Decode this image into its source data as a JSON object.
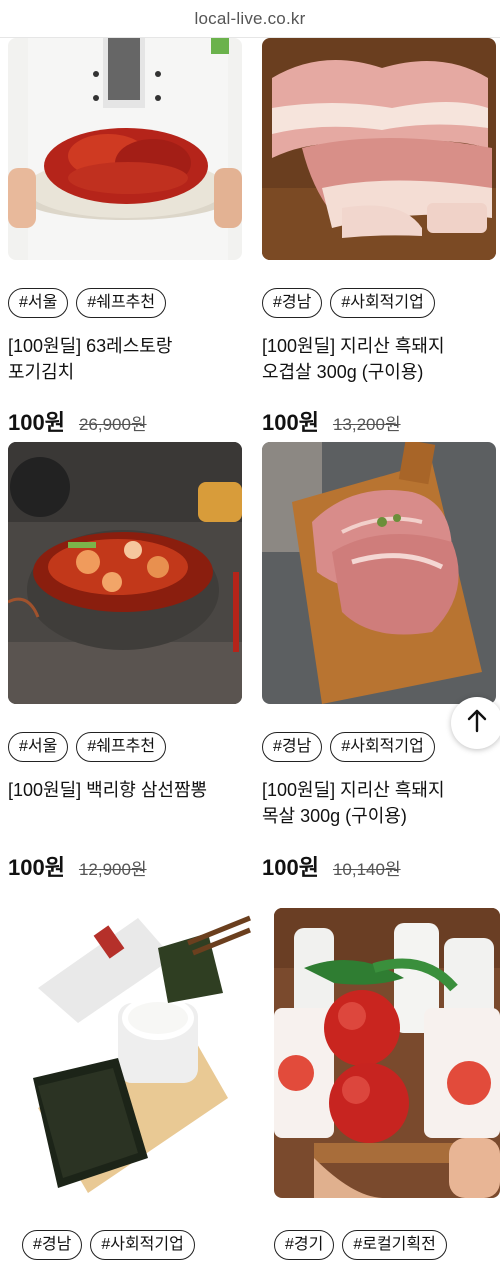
{
  "browser": {
    "url": "local-live.co.kr"
  },
  "products": [
    {
      "tags": [
        "#서울",
        "#쉐프추천"
      ],
      "title_lines": [
        "[100원딜] 63레스토랑",
        "포기김치"
      ],
      "price": "100원",
      "original_price": "26,900원"
    },
    {
      "tags": [
        "#경남",
        "#사회적기업"
      ],
      "title_lines": [
        "[100원딜] 지리산 흑돼지",
        "오겹살 300g (구이용)"
      ],
      "price": "100원",
      "original_price": "13,200원"
    },
    {
      "tags": [
        "#서울",
        "#쉐프추천"
      ],
      "title_lines": [
        "[100원딜] 백리향 삼선짬뽕",
        ""
      ],
      "price": "100원",
      "original_price": "12,900원"
    },
    {
      "tags": [
        "#경남",
        "#사회적기업"
      ],
      "title_lines": [
        "[100원딜] 지리산 흑돼지",
        "목살 300g (구이용)"
      ],
      "price": "100원",
      "original_price": "10,140원"
    },
    {
      "tags": [
        "#경남",
        "#사회적기업"
      ]
    },
    {
      "tags": [
        "#경기",
        "#로컬기획전"
      ]
    }
  ],
  "icons": {
    "scroll_top": "arrow-up-icon",
    "accent": "#111111"
  }
}
